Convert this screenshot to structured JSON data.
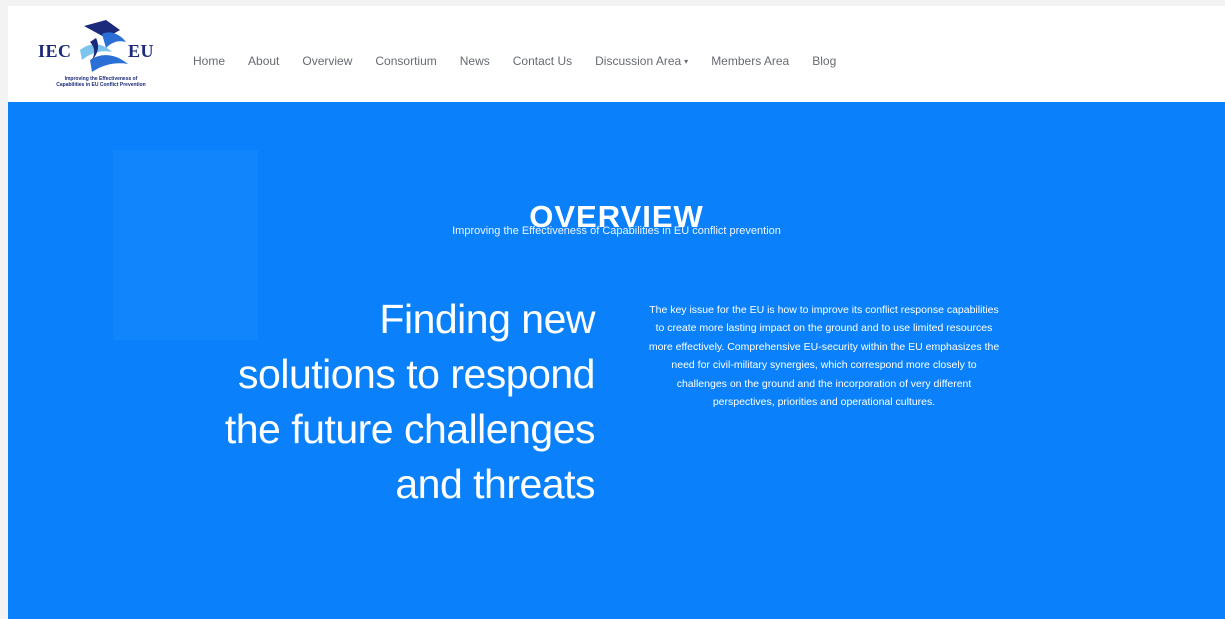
{
  "logo": {
    "left_text": "IEC",
    "right_text": "EU",
    "tagline_line1": "Improving the Effectiveness of",
    "tagline_line2": "Capabilities in EU Conflict Prevention",
    "colors": {
      "navy": "#1b2a7a",
      "blue": "#2a6fd6",
      "light": "#7cc4ee"
    }
  },
  "nav": {
    "items": [
      {
        "label": "Home"
      },
      {
        "label": "About"
      },
      {
        "label": "Overview"
      },
      {
        "label": "Consortium"
      },
      {
        "label": "News"
      },
      {
        "label": "Contact Us"
      },
      {
        "label": "Discussion Area",
        "caret": "▾"
      },
      {
        "label": "Members Area"
      },
      {
        "label": "Blog"
      }
    ]
  },
  "hero": {
    "title": "OVERVIEW",
    "subtitle": "Improving the Effectiveness of Capabilities in EU conflict prevention",
    "headline_lines": [
      "Finding new",
      "solutions to respond",
      "the future challenges",
      "and threats"
    ],
    "body_lines": [
      "The key issue for the EU is how to improve its conflict response capabilities",
      "to create more lasting impact on the ground and to use limited resources",
      "more effectively. Comprehensive EU-security within the EU emphasizes the",
      "need for civil-military synergies, which correspond more closely to",
      "challenges on the ground and the incorporation of very different",
      "perspectives, priorities and operational cultures."
    ],
    "background_color": "#0a81fb"
  }
}
